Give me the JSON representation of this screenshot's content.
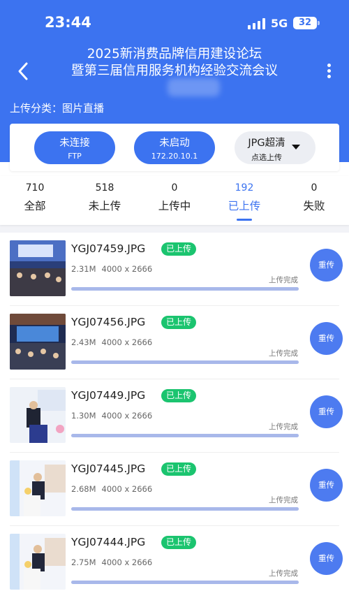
{
  "status_bar": {
    "time": "23:44",
    "network": "5G",
    "battery": "32"
  },
  "header": {
    "title_line1": "2025新消费品牌信用建设论坛",
    "title_line2": "暨第三届信用服务机构经验交流会议",
    "category_label": "上传分类：图片直播"
  },
  "controls": {
    "connection": {
      "status": "未连接",
      "sub": "FTP"
    },
    "startup": {
      "status": "未启动",
      "sub": "172.20.10.1"
    },
    "quality": {
      "label": "JPG超清",
      "sub": "点选上传"
    }
  },
  "tabs": [
    {
      "count": "710",
      "label": "全部"
    },
    {
      "count": "518",
      "label": "未上传"
    },
    {
      "count": "0",
      "label": "上传中"
    },
    {
      "count": "192",
      "label": "已上传",
      "active": true
    },
    {
      "count": "0",
      "label": "失败"
    }
  ],
  "items": [
    {
      "filename": "YGJ07459.JPG",
      "status": "已上传",
      "size": "2.31M",
      "dimensions": "4000 x 2666",
      "progress_label": "上传完成",
      "progress": 1.0,
      "action": "重传"
    },
    {
      "filename": "YGJ07456.JPG",
      "status": "已上传",
      "size": "2.43M",
      "dimensions": "4000 x 2666",
      "progress_label": "上传完成",
      "progress": 1.0,
      "action": "重传"
    },
    {
      "filename": "YGJ07449.JPG",
      "status": "已上传",
      "size": "1.30M",
      "dimensions": "4000 x 2666",
      "progress_label": "上传完成",
      "progress": 1.0,
      "action": "重传"
    },
    {
      "filename": "YGJ07445.JPG",
      "status": "已上传",
      "size": "2.68M",
      "dimensions": "4000 x 2666",
      "progress_label": "上传完成",
      "progress": 1.0,
      "action": "重传"
    },
    {
      "filename": "YGJ07444.JPG",
      "status": "已上传",
      "size": "2.75M",
      "dimensions": "4000 x 2666",
      "progress_label": "上传完成",
      "progress": 1.0,
      "action": "重传"
    }
  ],
  "colors": {
    "primary": "#3c73f0",
    "success": "#1bc46f",
    "progress": "#a8b8ea"
  },
  "icons": {
    "back": "chevron-left-icon",
    "more": "more-vertical-icon",
    "dropdown": "caret-down-icon"
  }
}
